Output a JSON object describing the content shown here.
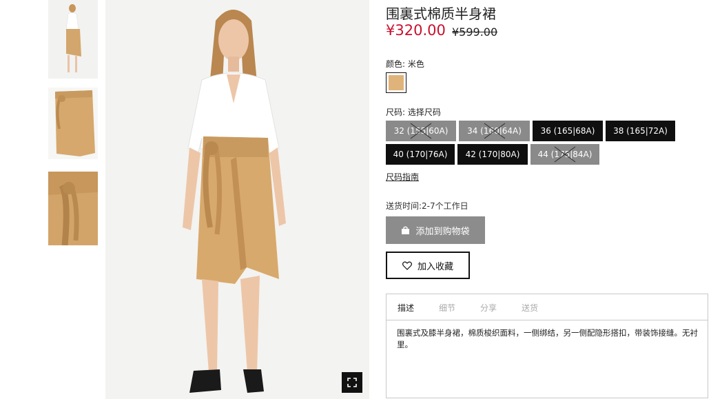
{
  "gallery": {
    "thumbnails": [
      {
        "name": "thumb-model-full"
      },
      {
        "name": "thumb-skirt-flat"
      },
      {
        "name": "thumb-skirt-detail"
      }
    ]
  },
  "product": {
    "title": "围裏式棉质半身裙",
    "price": "¥320.00",
    "original_price": "¥599.00"
  },
  "color": {
    "label": "颜色: 米色",
    "swatch_hex": "#e0b37a"
  },
  "size": {
    "label": "尺码: 选择尺码",
    "options": [
      {
        "label": "32 (155|60A)",
        "available": false
      },
      {
        "label": "34 (160|64A)",
        "available": false
      },
      {
        "label": "36 (165|68A)",
        "available": true
      },
      {
        "label": "38 (165|72A)",
        "available": true
      },
      {
        "label": "40 (170|76A)",
        "available": true
      },
      {
        "label": "42 (170|80A)",
        "available": true
      },
      {
        "label": "44 (175|84A)",
        "available": false
      }
    ],
    "guide_label": "尺码指南"
  },
  "delivery": {
    "text": "送货时间:2-7个工作日"
  },
  "actions": {
    "add_to_bag": "添加到购物袋",
    "add_to_bag_icon": "shopping-bag-icon",
    "favorite": "加入收藏",
    "favorite_icon": "heart-icon"
  },
  "tabs": [
    {
      "label": "描述",
      "active": true
    },
    {
      "label": "细节",
      "active": false
    },
    {
      "label": "分享",
      "active": false
    },
    {
      "label": "送货",
      "active": false
    }
  ],
  "description": "围裏式及膝半身裙，棉质梭织面料，一侧绑结，另一侧配隐形搭扣，带装饰接缝。无衬里。",
  "colors": {
    "price_red": "#c8102e",
    "swatch_beige": "#e0b37a",
    "soldout_grey": "#8a8a8a",
    "available_black": "#0f0f0f"
  }
}
